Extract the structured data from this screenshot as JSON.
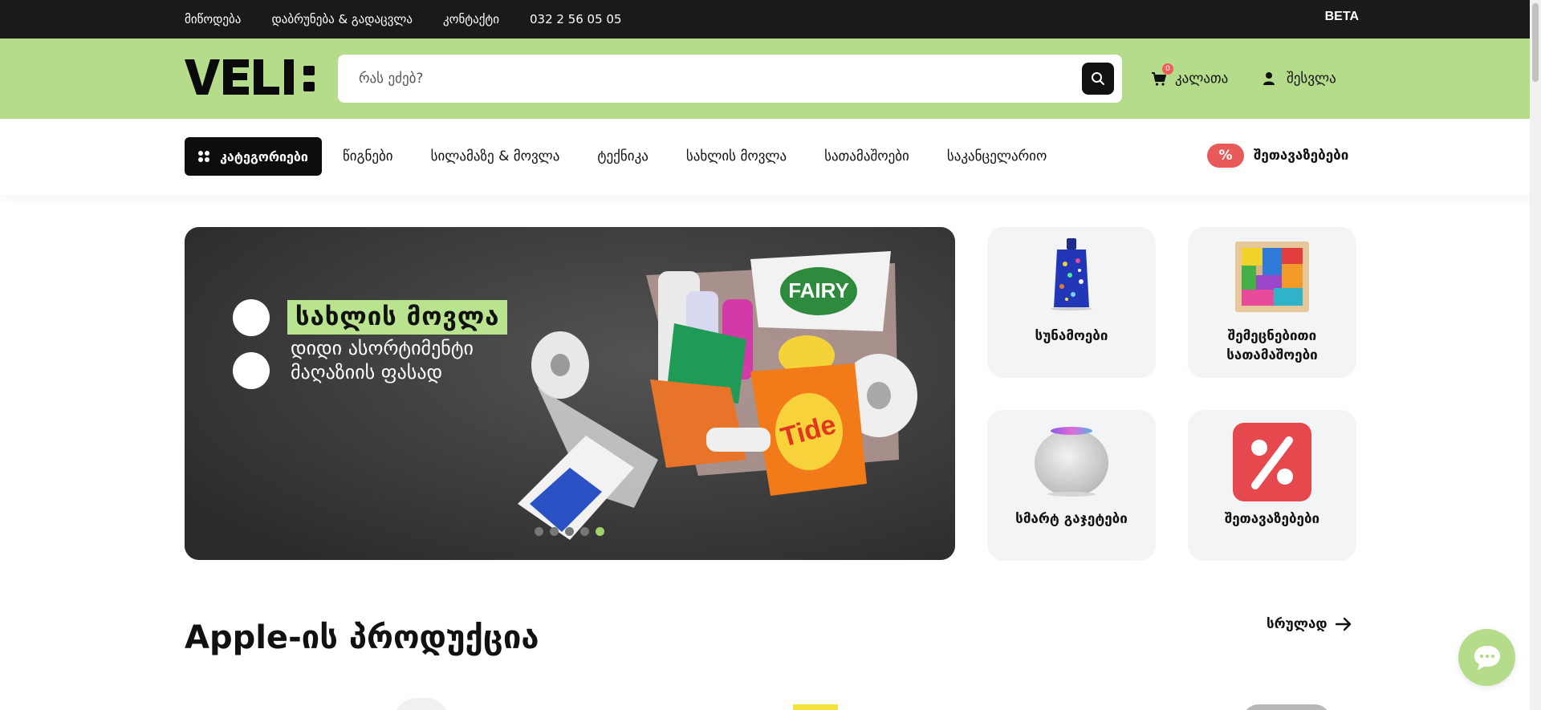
{
  "topbar": {
    "links": [
      "მიწოდება",
      "დაბრუნება & გადაცვლა",
      "კონტაქტი",
      "032 2 56 05 05"
    ],
    "badge": "BETA"
  },
  "header": {
    "logo_text": "VELI:",
    "search_placeholder": "რას ეძებ?",
    "cart_label": "კალათა",
    "cart_count": "0",
    "login_label": "შესვლა"
  },
  "nav": {
    "categories_label": "კატეგორიები",
    "links": [
      "წიგნები",
      "სილამაზე & მოვლა",
      "ტექნიკა",
      "სახლის მოვლა",
      "სათამაშოები",
      "საკანცელარიო"
    ],
    "offers_icon": "%",
    "offers_label": "შეთავაზებები"
  },
  "banner": {
    "title": "სახლის მოვლა",
    "subtitle": "დიდი ასორტიმენტი მაღაზიის ფასად",
    "slide_count": 5,
    "active_slide": 5
  },
  "cards": [
    {
      "label": "სუნამოები",
      "icon": "perfume-bottle-icon"
    },
    {
      "label": "შემეცნებითი სათამაშოები",
      "icon": "puzzle-icon"
    },
    {
      "label": "სმარტ გაჯეტები",
      "icon": "smart-speaker-icon"
    },
    {
      "label": "შეთავაზებები",
      "icon": "percent-icon"
    }
  ],
  "section": {
    "title": "Apple-ის პროდუქცია",
    "see_all": "სრულად"
  },
  "colors": {
    "brand_green": "#b5dc8a",
    "topbar": "#1a1a1a",
    "accent_red": "#e85a5a"
  }
}
